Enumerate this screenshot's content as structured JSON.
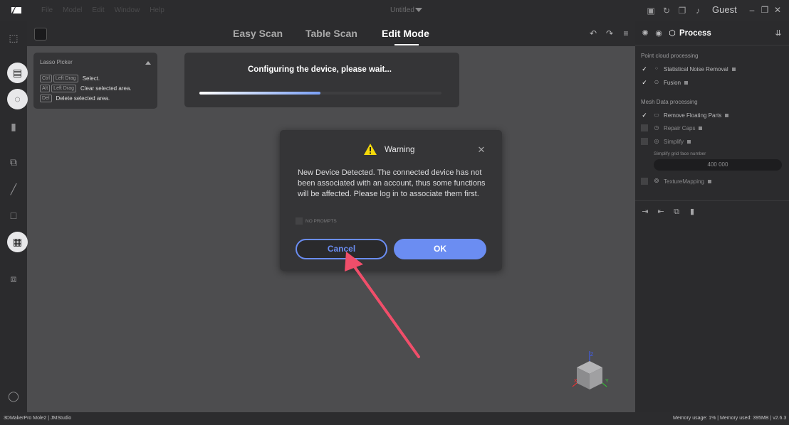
{
  "titlebar": {
    "menu": [
      "File",
      "Model",
      "Edit",
      "Window",
      "Help"
    ],
    "project": "Untitled",
    "user": "Guest"
  },
  "modebar": {
    "tabs": [
      {
        "label": "Easy Scan",
        "active": false
      },
      {
        "label": "Table Scan",
        "active": false
      },
      {
        "label": "Edit Mode",
        "active": true
      }
    ]
  },
  "lasso": {
    "title": "Lasso Picker",
    "rows": [
      {
        "keys": [
          "Ctrl",
          "Left Drag"
        ],
        "desc": "Select."
      },
      {
        "keys": [
          "Alt",
          "Left Drag"
        ],
        "desc": "Clear selected area."
      },
      {
        "keys": [
          "Del"
        ],
        "desc": "Delete selected area."
      }
    ]
  },
  "progress": {
    "text": "Configuring the device, please wait...",
    "fraction": 0.5
  },
  "process": {
    "title": "Process",
    "point_cloud_title": "Point cloud processing",
    "point_cloud_items": [
      "Statistical Noise Removal",
      "Fusion"
    ],
    "mesh_title": "Mesh Data processing",
    "mesh_items": [
      "Remove Floating Parts",
      "Repair Caps",
      "Simplify"
    ],
    "simplify_label": "Simplify grid face number",
    "simplify_value": "400 000",
    "texture_item": "TextureMapping"
  },
  "warning": {
    "title": "Warning",
    "message": "New Device Detected. The connected device has not been associated with an account, thus some functions will be affected. Please log in to associate them first.",
    "no_prompts": "NO PROMPTS",
    "cancel_label": "Cancel",
    "ok_label": "OK"
  },
  "viewcube": {
    "z": "Z",
    "x": "X",
    "y": "Y"
  },
  "status": {
    "left": "3DMakerPro Mole2 | JMStudio",
    "right": "Memory usage: 1% | Memory used: 395MB | v2.6.3"
  },
  "colors": {
    "accent": "#6b8df2",
    "arrow": "#f04e6a",
    "warning": "#f5d90a"
  }
}
